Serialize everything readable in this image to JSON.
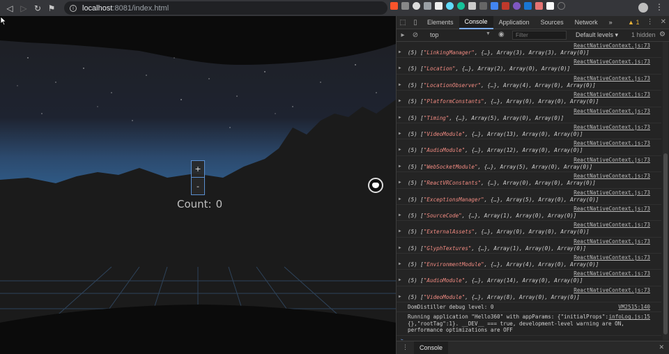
{
  "browser": {
    "url_host": "localhost",
    "url_path": ":8081/index.html"
  },
  "scene": {
    "count_label": "Count:",
    "count_value": "0",
    "increment_label": "+",
    "decrement_label": "-"
  },
  "devtools": {
    "tabs": [
      "Elements",
      "Console",
      "Application",
      "Sources",
      "Network"
    ],
    "active_tab": "Console",
    "more_tabs": "»",
    "warning_count": "1",
    "context": "top",
    "filter_placeholder": "Filter",
    "levels": "Default levels ▾",
    "hidden_count": "1 hidden",
    "log_source": "ReactNativeContext.js:73",
    "logs": [
      {
        "prefix": "(5) [",
        "name": "\"LinkingManager\"",
        "rest": ", {…}, Array(3), Array(3), Array(0)]"
      },
      {
        "prefix": "(5) [",
        "name": "\"Location\"",
        "rest": ", {…}, Array(2), Array(0), Array(0)]"
      },
      {
        "prefix": "(5) [",
        "name": "\"LocationObserver\"",
        "rest": ", {…}, Array(4), Array(0), Array(0)]"
      },
      {
        "prefix": "(5) [",
        "name": "\"PlatformConstants\"",
        "rest": ", {…}, Array(0), Array(0), Array(0)]"
      },
      {
        "prefix": "(5) [",
        "name": "\"Timing\"",
        "rest": ", {…}, Array(5), Array(0), Array(0)]"
      },
      {
        "prefix": "(5) [",
        "name": "\"VideoModule\"",
        "rest": ", {…}, Array(13), Array(0), Array(0)]"
      },
      {
        "prefix": "(5) [",
        "name": "\"AudioModule\"",
        "rest": ", {…}, Array(12), Array(0), Array(0)]"
      },
      {
        "prefix": "(5) [",
        "name": "\"WebSocketModule\"",
        "rest": ", {…}, Array(5), Array(0), Array(0)]"
      },
      {
        "prefix": "(5) [",
        "name": "\"ReactVRConstants\"",
        "rest": ", {…}, Array(0), Array(0), Array(0)]"
      },
      {
        "prefix": "(5) [",
        "name": "\"ExceptionsManager\"",
        "rest": ", {…}, Array(5), Array(0), Array(0)]"
      },
      {
        "prefix": "(5) [",
        "name": "\"SourceCode\"",
        "rest": ", {…}, Array(1), Array(0), Array(0)]"
      },
      {
        "prefix": "(5) [",
        "name": "\"ExternalAssets\"",
        "rest": ", {…}, Array(0), Array(0), Array(0)]"
      },
      {
        "prefix": "(5) [",
        "name": "\"GlyphTextures\"",
        "rest": ", {…}, Array(1), Array(0), Array(0)]"
      },
      {
        "prefix": "(5) [",
        "name": "\"EnvironmentModule\"",
        "rest": ", {…}, Array(4), Array(0), Array(0)]"
      },
      {
        "prefix": "(5) [",
        "name": "\"AudioModule\"",
        "rest": ", {…}, Array(14), Array(0), Array(0)]"
      },
      {
        "prefix": "(5) [",
        "name": "\"VideoModule\"",
        "rest": ", {…}, Array(8), Array(0), Array(0)]"
      }
    ],
    "distiller": {
      "text": "DomDistiller debug level: 0",
      "source": "VM2515:140"
    },
    "running": {
      "line1": "Running application \"Hello360\" with appParams: {\"initialProps\":",
      "line2": "{},\"rootTag\":1}. __DEV__ === true, development-level warning are ON,",
      "line3": "performance optimizations are OFF",
      "source": "infoLog.js:15"
    },
    "prompt": ">",
    "drawer_tab": "Console"
  },
  "colors": {
    "accent": "#7cacf8",
    "string_red": "#f28b82",
    "panel_border": "#5a8fd0"
  }
}
